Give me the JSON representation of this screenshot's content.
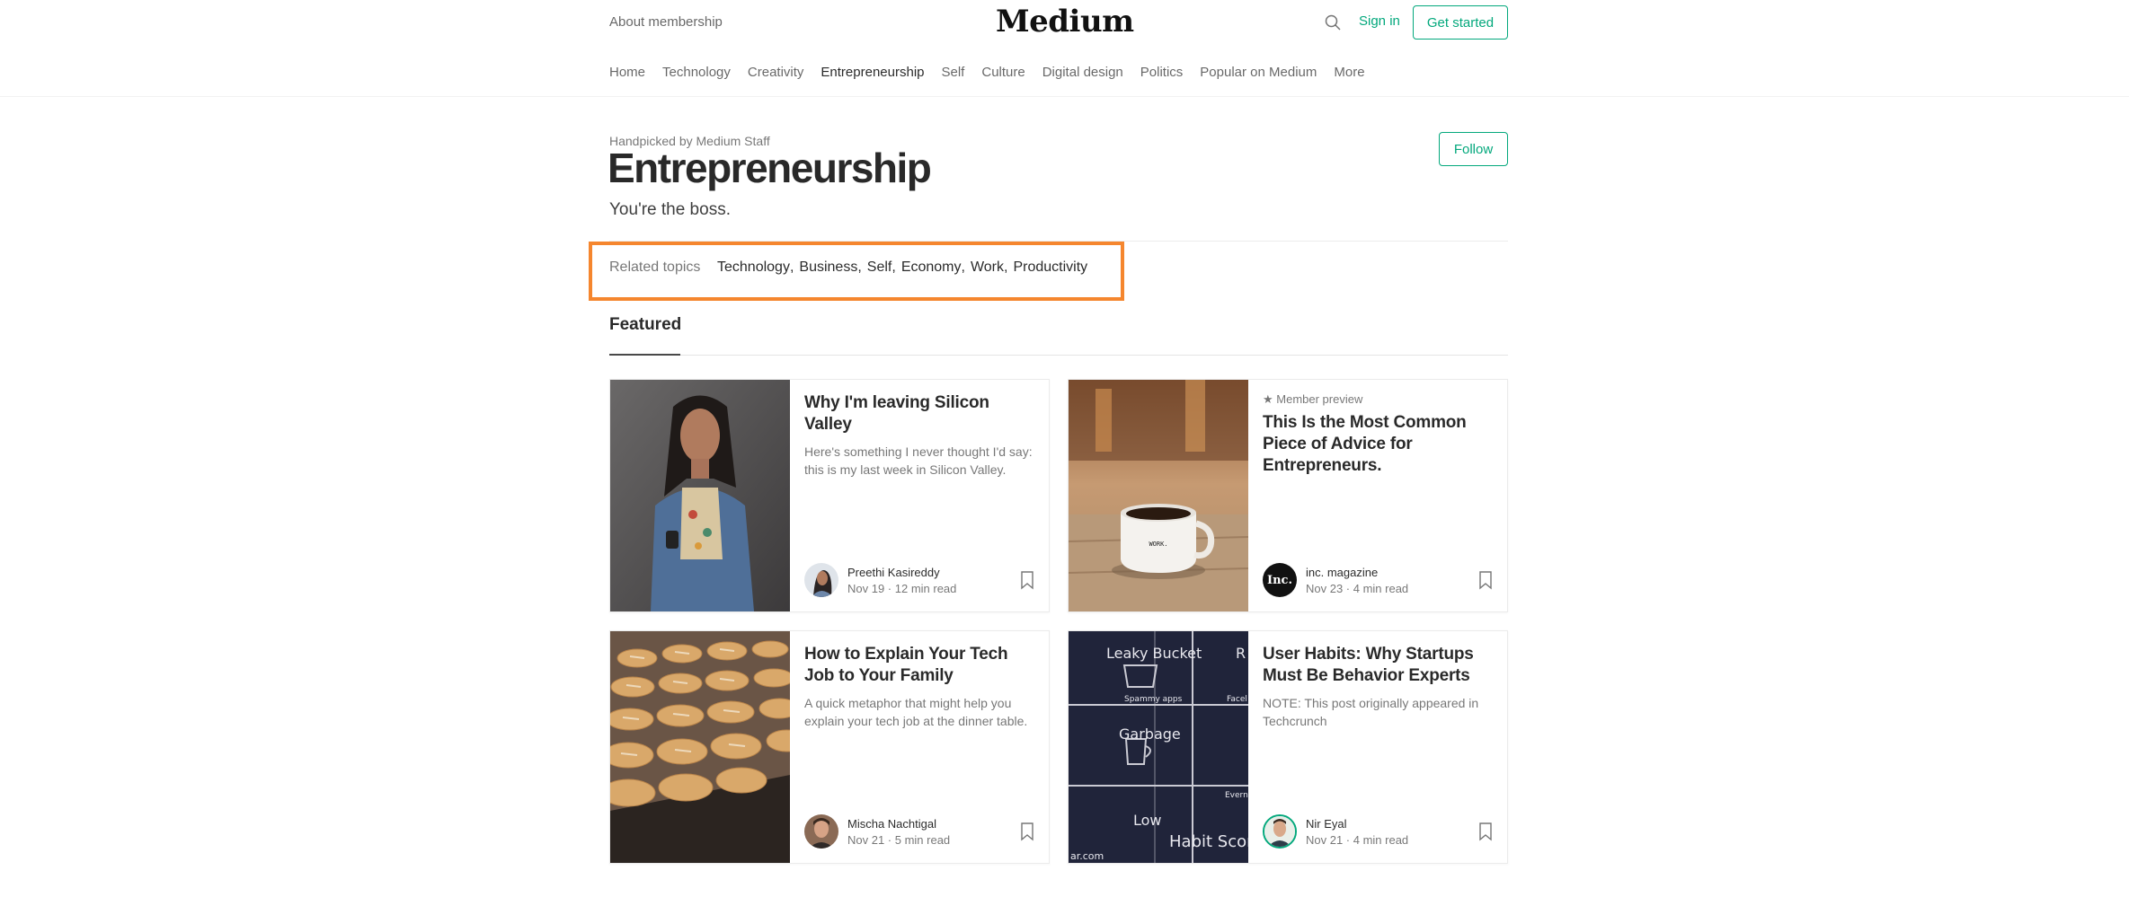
{
  "header": {
    "about": "About membership",
    "logo": "Medium",
    "search_icon": "search-icon",
    "signin": "Sign in",
    "get_started": "Get started"
  },
  "nav": {
    "items": [
      "Home",
      "Technology",
      "Creativity",
      "Entrepreneurship",
      "Self",
      "Culture",
      "Digital design",
      "Politics",
      "Popular on Medium",
      "More"
    ],
    "active": "Entrepreneurship"
  },
  "topic": {
    "handpicked": "Handpicked by Medium Staff",
    "title": "Entrepreneurship",
    "tagline": "You're the boss.",
    "follow": "Follow"
  },
  "related": {
    "label": "Related topics",
    "topics": [
      "Technology",
      "Business",
      "Self",
      "Economy",
      "Work",
      "Productivity"
    ],
    "highlight_color": "#f5862e"
  },
  "featured": {
    "label": "Featured"
  },
  "cards": [
    {
      "preview": "",
      "title": "Why I'm leaving Silicon Valley",
      "subtitle": "Here's something I never thought I'd say: this is my last week in Silicon Valley.",
      "author": "Preethi Kasireddy",
      "meta": "Nov 19 · 12 min read"
    },
    {
      "preview": "★ Member preview",
      "title": "This Is the Most Common Piece of Advice for Entrepreneurs.",
      "subtitle": "",
      "author": "inc. magazine",
      "meta": "Nov 23 · 4 min read",
      "avatar_text": "Inc."
    },
    {
      "preview": "",
      "title": "How to Explain Your Tech Job to Your Family",
      "subtitle": "A quick metaphor that might help you explain your tech job at the dinner table.",
      "author": "Mischa Nachtigal",
      "meta": "Nov 21 · 5 min read"
    },
    {
      "preview": "",
      "title": "User Habits: Why Startups Must Be Behavior Experts",
      "subtitle": "NOTE: This post originally appeared in Techcrunch",
      "author": "Nir Eyal",
      "meta": "Nov 21 · 4 min read"
    }
  ],
  "thumb_text": {
    "mug_label": "WORK.",
    "chalk_leaky": "Leaky Bucket",
    "chalk_spammy": "Spammy apps",
    "chalk_garbage": "Garbage",
    "chalk_low": "Low",
    "chalk_habit": "Habit Scor",
    "chalk_r": "R",
    "chalk_face": "Facel",
    "chalk_every": "Everna",
    "chalk_com": "ar.com"
  },
  "colors": {
    "accent": "#03a87c",
    "highlight": "#f5862e"
  }
}
